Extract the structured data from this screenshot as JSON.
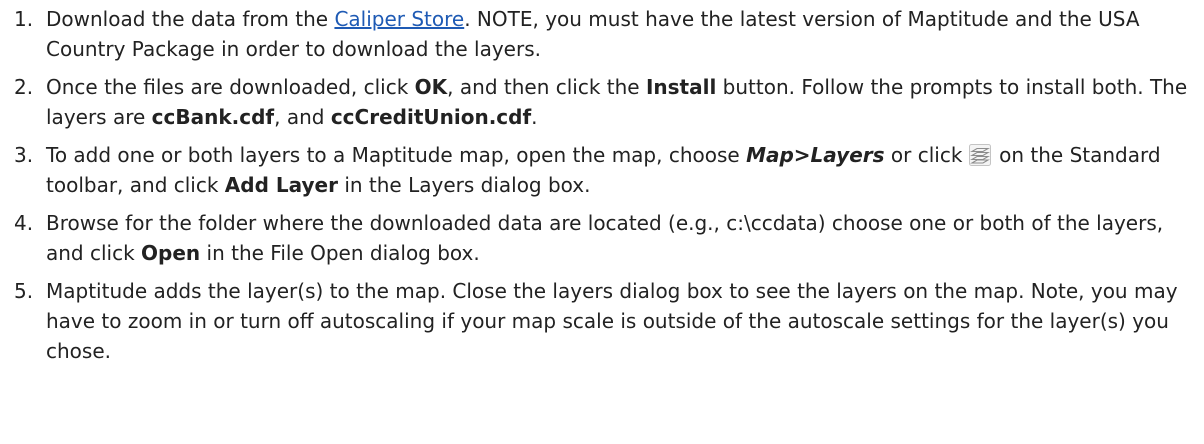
{
  "steps": [
    {
      "num": "1.",
      "t1": "Download the data from the ",
      "link": "Caliper Store",
      "t2": ". NOTE, you must have the latest version of Maptitude and the USA Country Package in order to download the layers."
    },
    {
      "num": "2.",
      "t1": "Once the files are downloaded, click ",
      "b1": "OK",
      "t2": ", and then click the ",
      "b2": "Install",
      "t3": " button. Follow the prompts to install both. The layers are ",
      "b3": "ccBank.cdf",
      "t4": ", and ",
      "b4": "ccCreditUnion.cdf",
      "t5": "."
    },
    {
      "num": "3.",
      "t1": "To add one or both layers to a Maptitude map, open the map, choose ",
      "bi1": "Map>Layers",
      "t2": " or click ",
      "icon": "layers-icon",
      "t3": " on the Standard toolbar, and click ",
      "b1": "Add Layer",
      "t4": " in the Layers dialog box."
    },
    {
      "num": "4.",
      "t1": "Browse for the folder where the downloaded data are located (e.g., c:\\ccdata) choose one or both of the layers, and click ",
      "b1": "Open",
      "t2": " in the File Open dialog box."
    },
    {
      "num": "5.",
      "t1": "Maptitude adds the layer(s) to the map. Close the layers dialog box to see the layers on the map. Note, you may have to zoom in or turn off autoscaling if your map scale is outside of the autoscale settings for the layer(s) you chose."
    }
  ]
}
